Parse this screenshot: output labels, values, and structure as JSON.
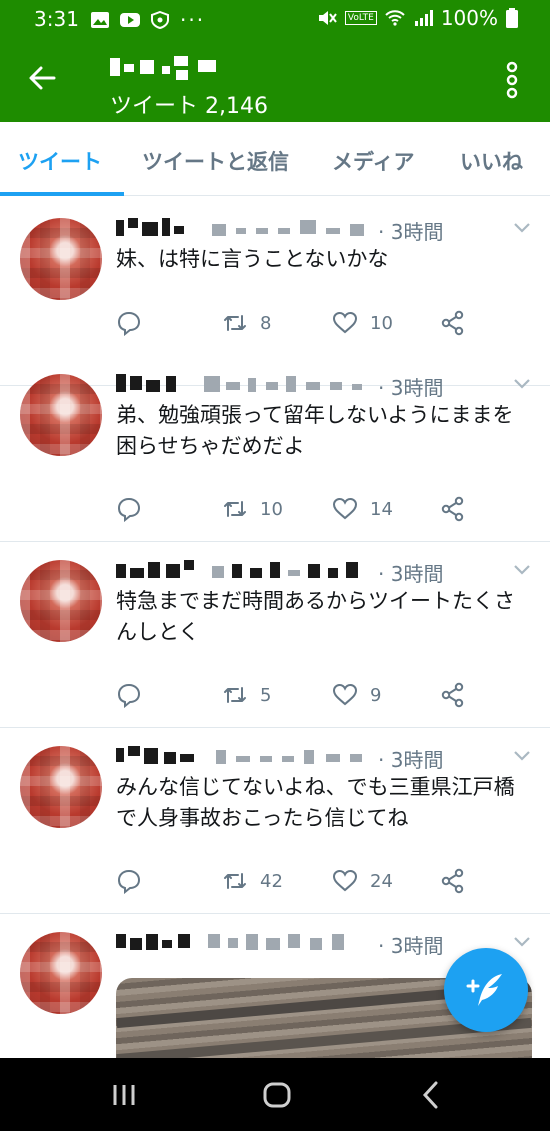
{
  "status_bar": {
    "time": "3:31",
    "dots": "···",
    "battery": "100%",
    "volte": "VoLTE"
  },
  "app_bar": {
    "tweet_count": "ツイート 2,146",
    "accent": "#1e8c00"
  },
  "tabs": [
    {
      "label": "ツイート",
      "active": true
    },
    {
      "label": "ツイートと返信",
      "active": false
    },
    {
      "label": "メディア",
      "active": false
    },
    {
      "label": "いいね",
      "active": false
    }
  ],
  "tweets": [
    {
      "time": "· 3時間",
      "text": "妹、は特に言うことないかな",
      "retweets": "8",
      "likes": "10"
    },
    {
      "time": "· 3時間",
      "text": "弟、勉強頑張って留年しないようにままを困らせちゃだめだよ",
      "retweets": "10",
      "likes": "14"
    },
    {
      "time": "· 3時間",
      "text": "特急までまだ時間あるからツイートたくさんしとく",
      "retweets": "5",
      "likes": "9"
    },
    {
      "time": "· 3時間",
      "text": "みんな信じてないよね、でも三重県江戸橋で人身事故おこったら信じてね",
      "retweets": "42",
      "likes": "24"
    },
    {
      "time": "· 3時間",
      "text": "",
      "has_media": true
    }
  ],
  "icons": {
    "back": "arrow-left-icon",
    "more": "more-vertical-icon",
    "reply": "reply-icon",
    "retweet": "retweet-icon",
    "like": "heart-icon",
    "share": "share-icon",
    "compose": "compose-tweet-icon"
  },
  "colors": {
    "twitter_blue": "#1da1f2",
    "secondary_text": "#657786"
  }
}
